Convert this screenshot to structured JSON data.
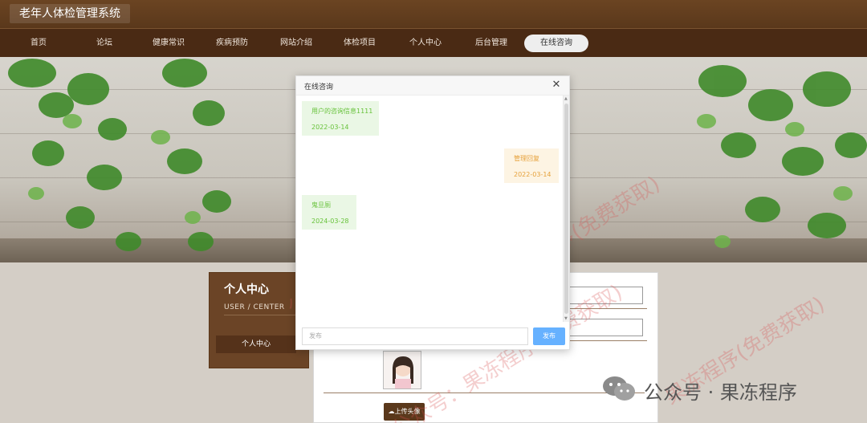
{
  "site": {
    "title": "老年人体检管理系统"
  },
  "nav": {
    "items": [
      {
        "label": "首页"
      },
      {
        "label": "论坛"
      },
      {
        "label": "健康常识"
      },
      {
        "label": "疾病预防"
      },
      {
        "label": "网站介绍"
      },
      {
        "label": "体检项目"
      },
      {
        "label": "个人中心"
      },
      {
        "label": "后台管理"
      },
      {
        "label": "在线咨询",
        "active": true
      }
    ]
  },
  "sidebar": {
    "title": "个人中心",
    "subtitle": "USER / CENTER",
    "menu_item": "个人中心"
  },
  "profile": {
    "upload_label": "上传头像"
  },
  "dialog": {
    "title": "在线咨询",
    "close_icon": "close-icon",
    "messages": [
      {
        "role": "user",
        "text": "用户的咨询信息1111",
        "date": "2022-03-14"
      },
      {
        "role": "admin",
        "text": "管理回复",
        "date": "2022-03-14"
      },
      {
        "role": "user",
        "text": "鬼旦厕",
        "date": "2024-03-28"
      }
    ],
    "input_placeholder": "发布",
    "send_label": "发布"
  },
  "watermark": {
    "text_a": "果冻程序(免费获取)",
    "text_b": "公众号：果冻程序(免费获取)"
  },
  "wechat": {
    "label": "公众号 · 果冻程序"
  },
  "colors": {
    "brand": "#5a381b",
    "nav_bg": "#4a2a14",
    "user_msg": "#67c23a",
    "admin_msg": "#e6a23c",
    "send_button": "#66b1ff"
  }
}
